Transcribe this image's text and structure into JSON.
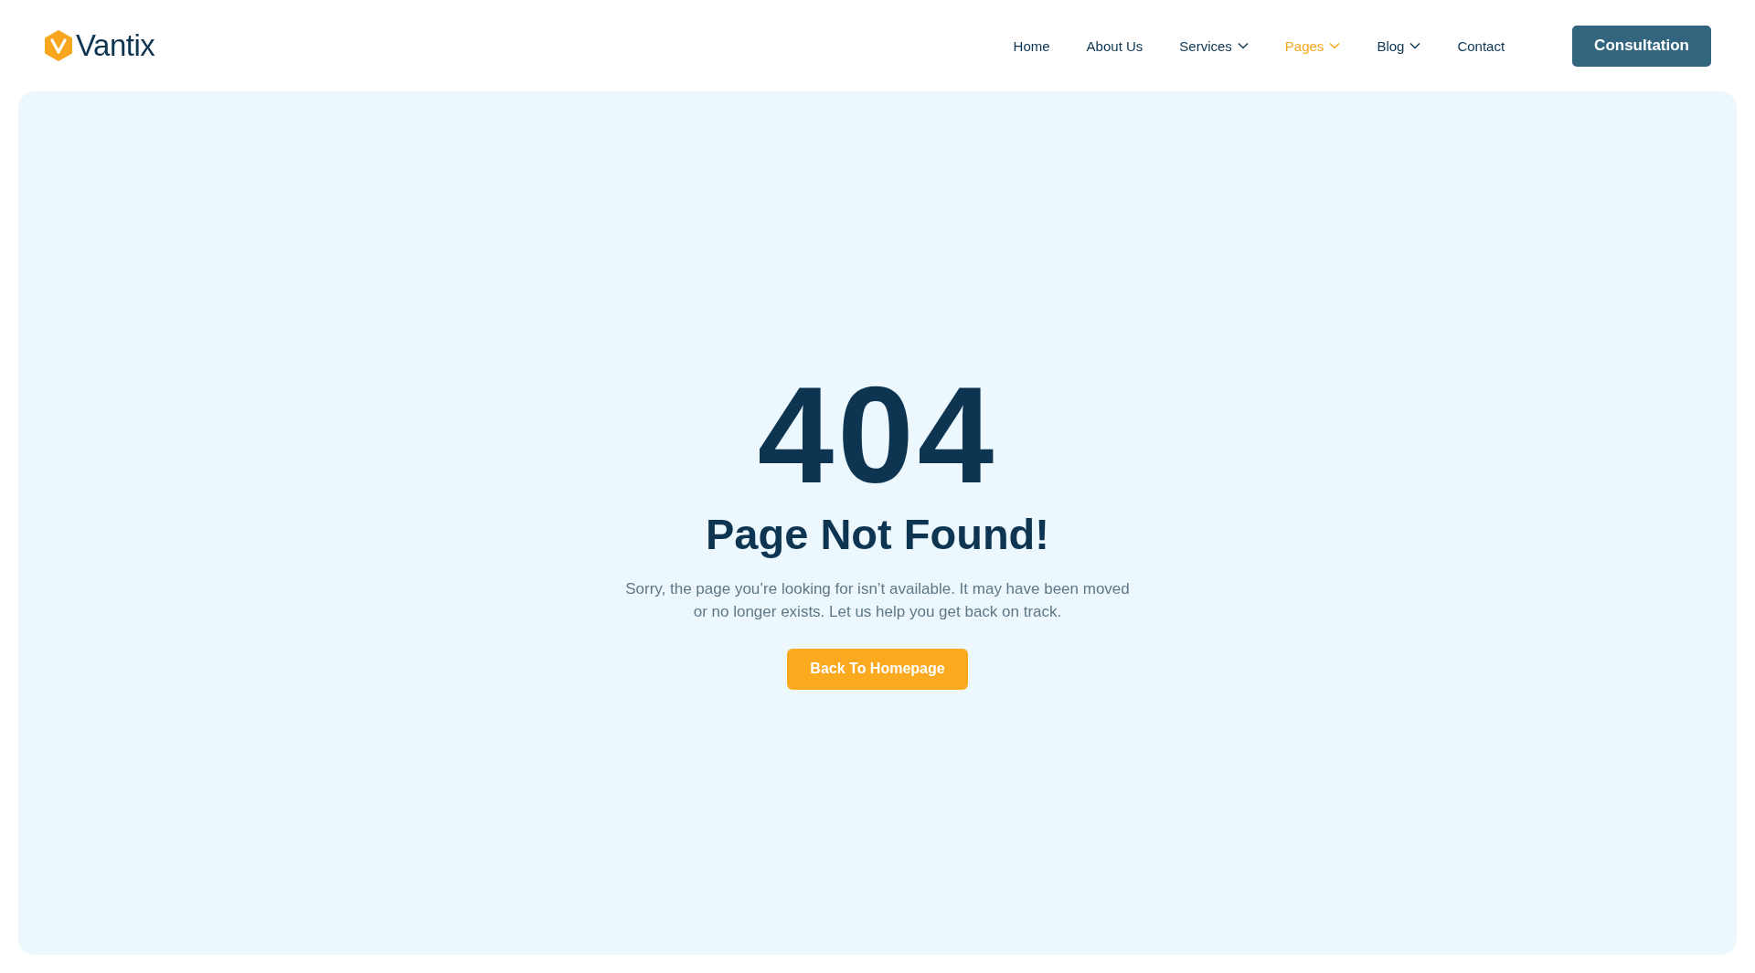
{
  "logo": {
    "text": "Vantix"
  },
  "nav": [
    {
      "label": "Home",
      "selected": false,
      "dropdown": false
    },
    {
      "label": "About Us",
      "selected": false,
      "dropdown": false
    },
    {
      "label": "Services",
      "selected": false,
      "dropdown": true
    },
    {
      "label": "Pages",
      "selected": true,
      "dropdown": true
    },
    {
      "label": "Blog",
      "selected": false,
      "dropdown": true
    },
    {
      "label": "Contact",
      "selected": false,
      "dropdown": false
    }
  ],
  "cta": "Consultation",
  "error": {
    "code": "404",
    "title": "Page Not Found!",
    "message": "Sorry, the page you’re looking for isn’t available. It may have been moved or no longer exists. Let us help you get back on track.",
    "button": "Back To Homepage"
  }
}
